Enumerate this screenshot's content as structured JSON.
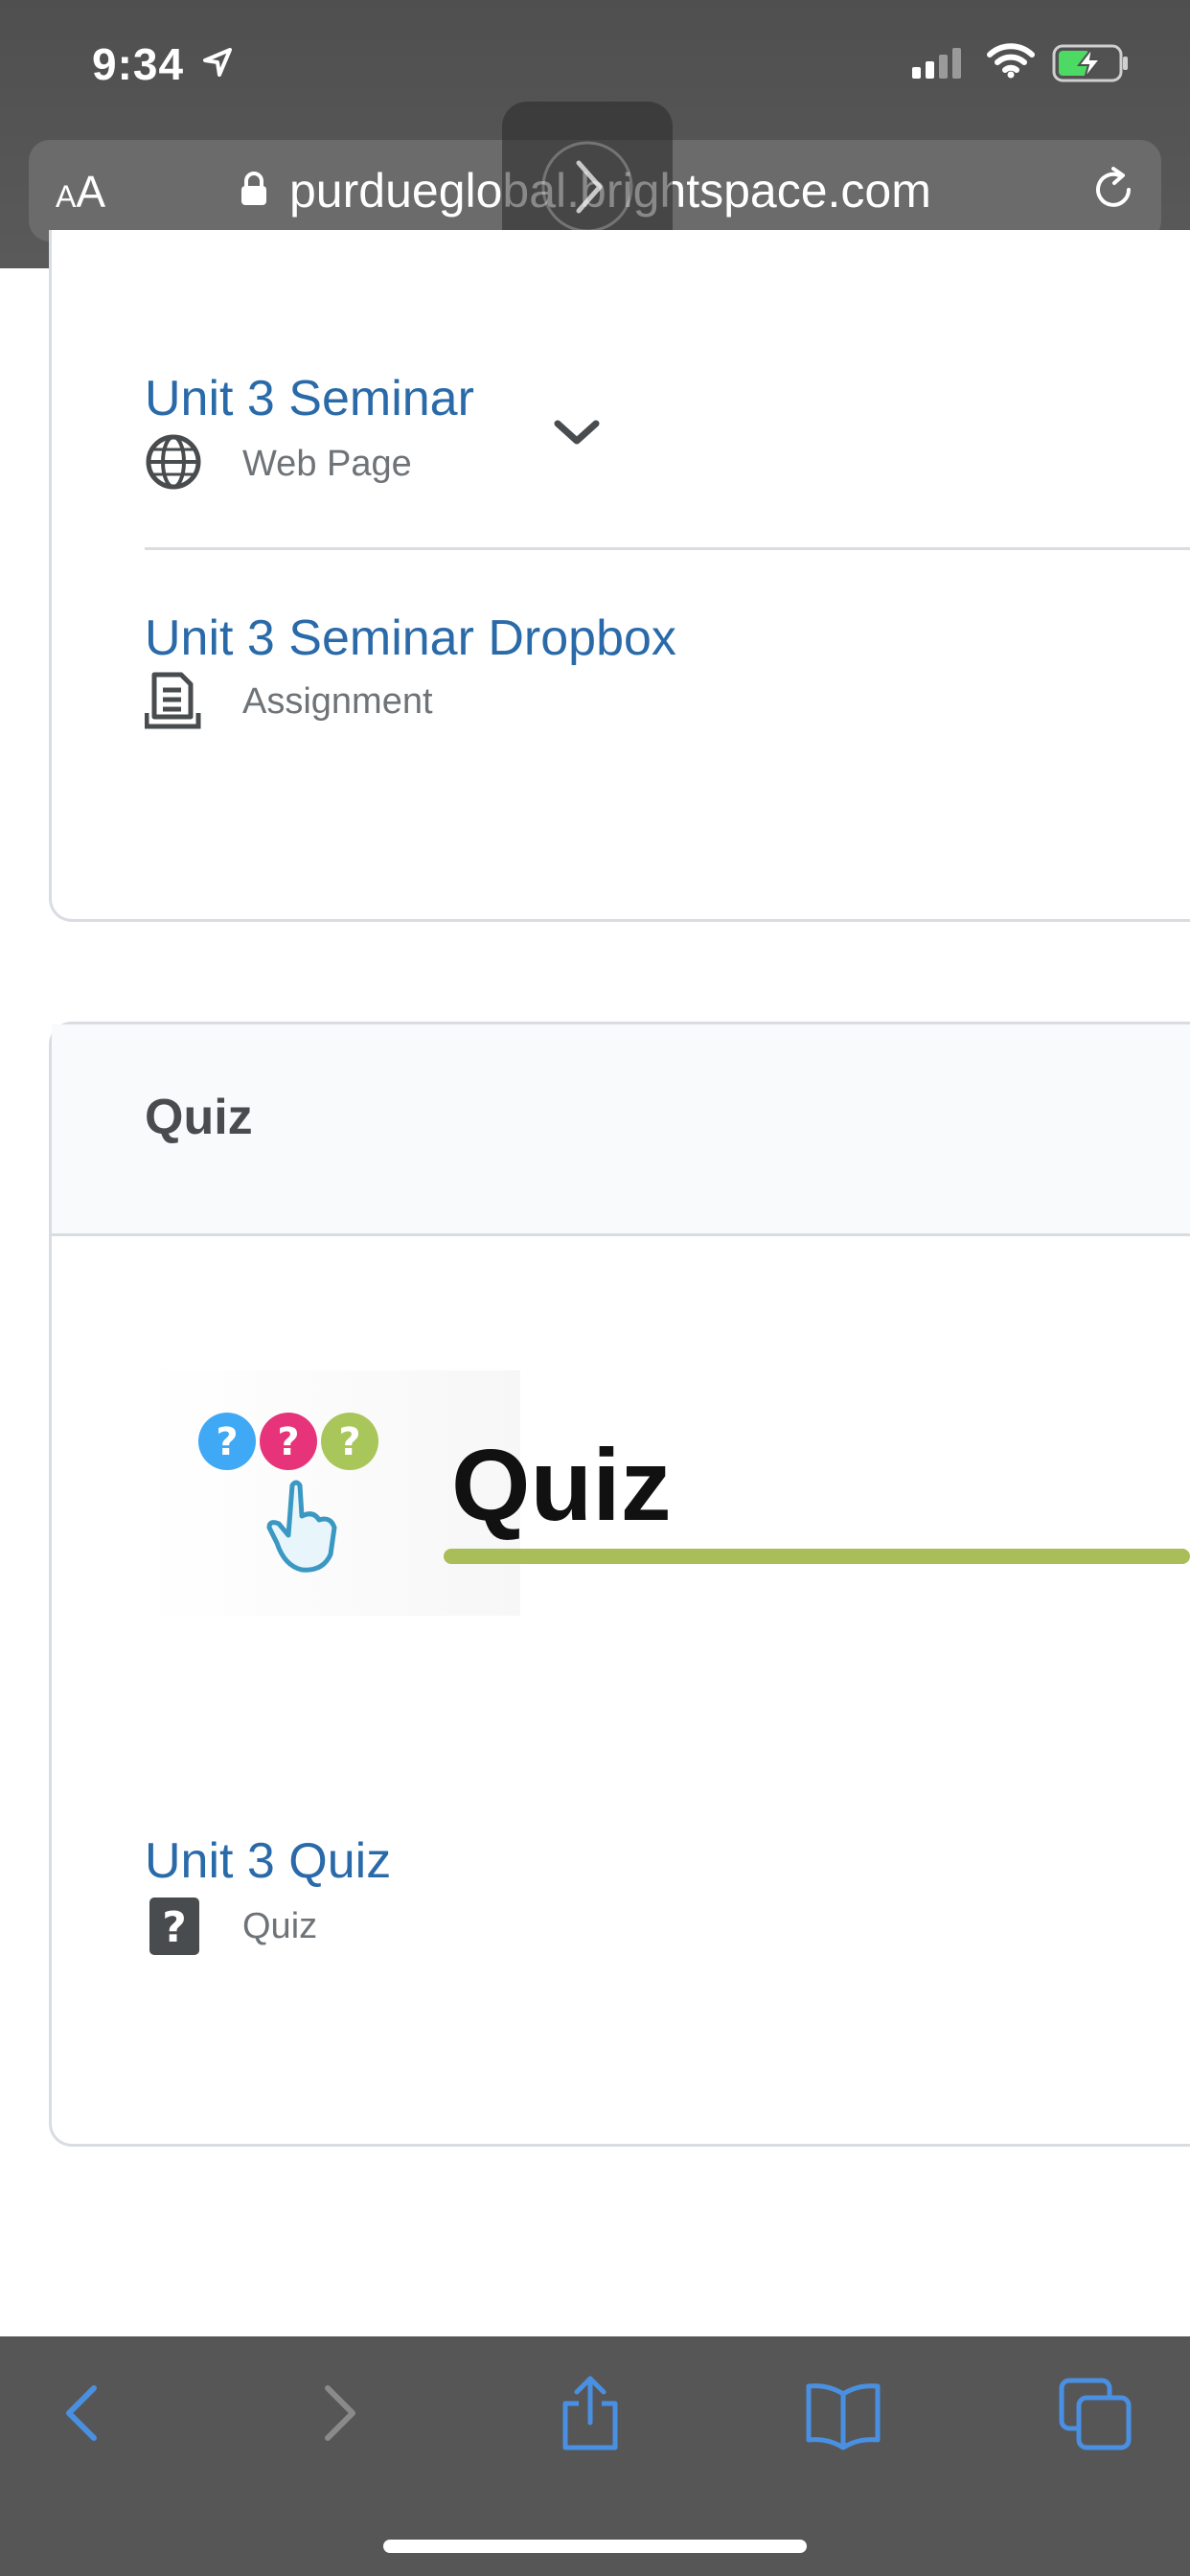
{
  "status_bar": {
    "time": "9:34",
    "icons": [
      "location-arrow-icon",
      "cellular-signal-icon",
      "wifi-icon",
      "battery-charging-icon"
    ]
  },
  "address_bar": {
    "text_size_label_small": "A",
    "text_size_label_large": "A",
    "url": "purdueglobal.brightspace.com",
    "icons": [
      "lock-icon",
      "reload-icon",
      "forward-icon"
    ]
  },
  "content": {
    "items": [
      {
        "title": "Unit 3 Seminar",
        "type": "Web Page",
        "icon": "globe-icon"
      },
      {
        "title": "Unit 3 Seminar Dropbox",
        "type": "Assignment",
        "icon": "assignment-icon"
      }
    ],
    "quiz_section": {
      "heading": "Quiz",
      "banner_text": "Quiz",
      "item": {
        "title": "Unit 3 Quiz",
        "type": "Quiz",
        "icon": "quiz-question-icon"
      }
    }
  },
  "toolbar": {
    "icons": [
      "back-icon",
      "forward-icon",
      "share-icon",
      "bookmarks-icon",
      "tabs-icon"
    ]
  },
  "colors": {
    "link": "#2a6aa9",
    "chrome": "#565656",
    "toolbar_icon": "#4a90e2",
    "banner_accent": "#a9bd58"
  }
}
